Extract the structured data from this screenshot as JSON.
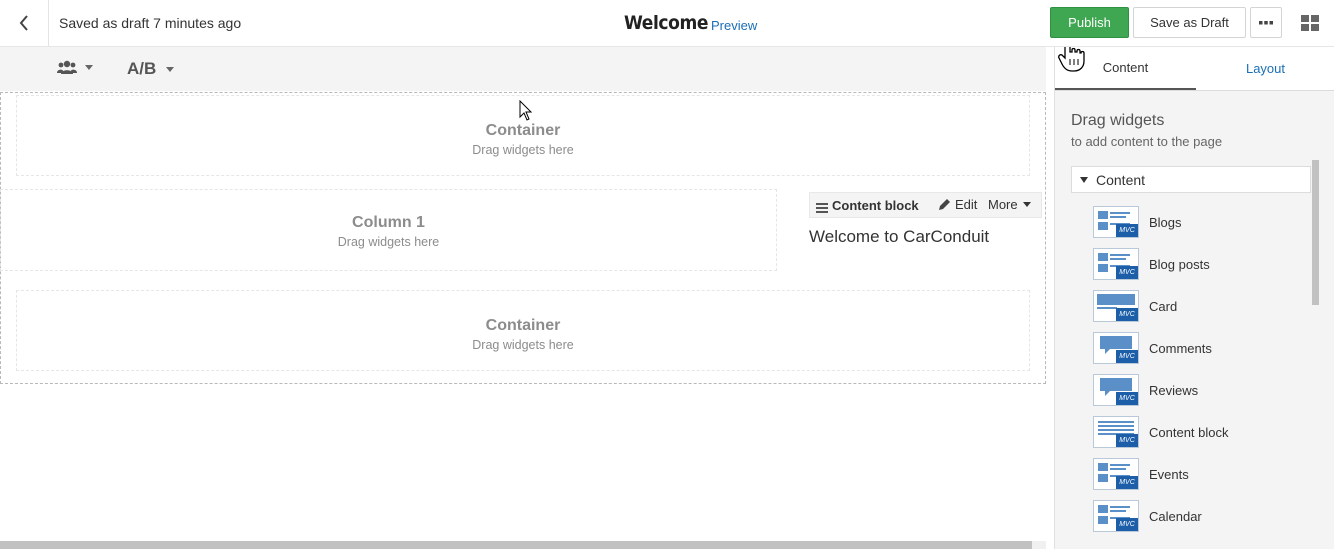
{
  "topbar": {
    "saved_status": "Saved as draft 7 minutes ago",
    "page_title": "Welcome",
    "preview_label": "Preview",
    "publish_label": "Publish",
    "save_draft_label": "Save as Draft",
    "accent_color": "#3fa651",
    "link_color": "#1b6fb5"
  },
  "toolbar": {
    "persona_icon": "users-icon",
    "ab_label": "A/B"
  },
  "canvas": {
    "top_container": {
      "title": "Container",
      "hint": "Drag widgets here"
    },
    "column1": {
      "title": "Column 1",
      "hint": "Drag widgets here"
    },
    "bottom_container": {
      "title": "Container",
      "hint": "Drag widgets here"
    },
    "content_block": {
      "title": "Content block",
      "edit_label": "Edit",
      "more_label": "More",
      "text": "Welcome to CarConduit"
    }
  },
  "sidebar": {
    "tabs": [
      {
        "label": "Content",
        "active": true
      },
      {
        "label": "Layout",
        "active": false
      }
    ],
    "heading": "Drag widgets",
    "subheading": "to add content to the page",
    "category": "Content",
    "widgets": [
      {
        "label": "Blogs",
        "icon": "blogs-icon"
      },
      {
        "label": "Blog posts",
        "icon": "blog-posts-icon"
      },
      {
        "label": "Card",
        "icon": "card-icon"
      },
      {
        "label": "Comments",
        "icon": "comments-icon"
      },
      {
        "label": "Reviews",
        "icon": "reviews-icon"
      },
      {
        "label": "Content block",
        "icon": "content-block-icon"
      },
      {
        "label": "Events",
        "icon": "events-icon"
      },
      {
        "label": "Calendar",
        "icon": "calendar-icon"
      }
    ],
    "mvc_badge": "MVC"
  }
}
